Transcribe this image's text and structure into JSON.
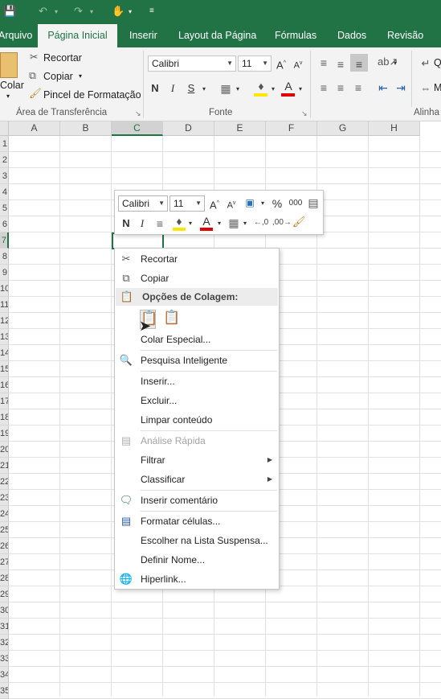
{
  "quick_access": {
    "save_icon": "save-icon",
    "undo_icon": "undo-icon",
    "redo_icon": "redo-icon",
    "touch_icon": "touch-mode-icon",
    "customize_icon": "customize-icon"
  },
  "tabs": [
    {
      "label": "Arquivo"
    },
    {
      "label": "Página Inicial"
    },
    {
      "label": "Inserir"
    },
    {
      "label": "Layout da Página"
    },
    {
      "label": "Fórmulas"
    },
    {
      "label": "Dados"
    },
    {
      "label": "Revisão"
    }
  ],
  "ribbon": {
    "clipboard": {
      "paste": "Colar",
      "cut": "Recortar",
      "copy": "Copiar",
      "format_painter": "Pincel de Formatação",
      "label": "Área de Transferência"
    },
    "font": {
      "name": "Calibri",
      "size": "11",
      "label": "Fonte",
      "bold": "N",
      "italic": "I",
      "underline": "S"
    },
    "alignment": {
      "label": "Alinha"
    }
  },
  "sheet": {
    "columns": [
      "A",
      "B",
      "C",
      "D",
      "E",
      "F",
      "G",
      "H"
    ],
    "rows": [
      "1",
      "2",
      "3",
      "4",
      "5",
      "6",
      "7",
      "8",
      "9",
      "10",
      "11",
      "12",
      "13",
      "14",
      "15",
      "16",
      "17",
      "18",
      "19",
      "20",
      "21",
      "22",
      "23",
      "24",
      "25",
      "26",
      "27",
      "28",
      "29",
      "30",
      "31",
      "32",
      "33",
      "34",
      "35"
    ],
    "selected_column": "C",
    "selected_row": "7"
  },
  "mini_toolbar": {
    "font": "Calibri",
    "size": "11",
    "bold": "N",
    "italic": "I",
    "percent": "%",
    "thousands": "000"
  },
  "context_menu": {
    "cut": "Recortar",
    "copy": "Copiar",
    "paste_options": "Opções de Colagem:",
    "paste_special": "Colar Especial...",
    "smart_lookup": "Pesquisa Inteligente",
    "insert": "Inserir...",
    "delete": "Excluir...",
    "clear": "Limpar conteúdo",
    "quick_analysis": "Análise Rápida",
    "filter": "Filtrar",
    "sort": "Classificar",
    "insert_comment": "Inserir comentário",
    "format_cells": "Formatar células...",
    "pick_list": "Escolher na Lista Suspensa...",
    "define_name": "Definir Nome...",
    "hyperlink": "Hiperlink..."
  },
  "colors": {
    "accent": "#217346",
    "highlight": "#ffe600",
    "font_red": "#e00000"
  }
}
